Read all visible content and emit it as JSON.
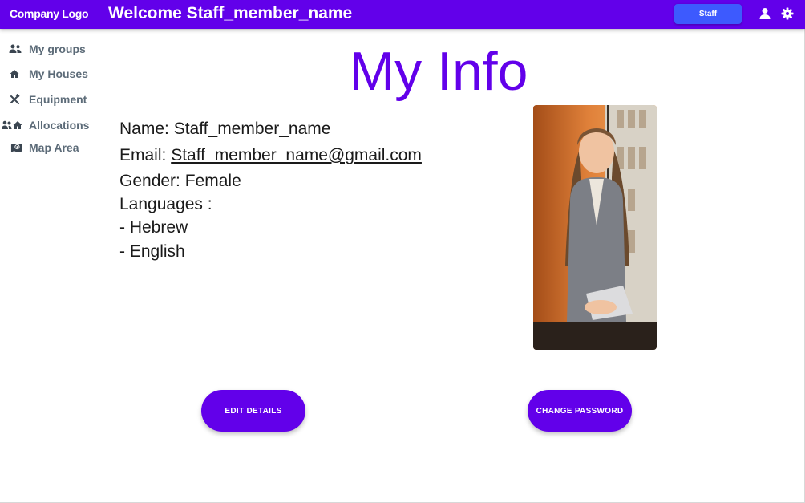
{
  "header": {
    "logo": "Company Logo",
    "welcome": "Welcome Staff_member_name",
    "role_button": "Staff",
    "icons": [
      "person-icon",
      "gear-icon"
    ]
  },
  "sidebar": {
    "items": [
      {
        "label": "My groups",
        "icon": "groups-icon"
      },
      {
        "label": "My Houses",
        "icon": "house-icon"
      },
      {
        "label": "Equipment",
        "icon": "tools-icon"
      },
      {
        "label": "Allocations",
        "icon": "allocations-icon"
      },
      {
        "label": "Map Area",
        "icon": "map-icon"
      }
    ]
  },
  "main": {
    "title": "My Info",
    "name_label": "Name:",
    "name_value": "Staff_member_name",
    "email_label": "Email:",
    "email_value": "Staff_member_name@gmail.com",
    "gender_label": "Gender:",
    "gender_value": "Female",
    "languages_label": "Languages :",
    "languages": [
      "- Hebrew",
      "- English"
    ],
    "edit_button": "EDIT DETAILS",
    "password_button": "CHANGE PASSWORD"
  },
  "colors": {
    "primary": "#6200ea",
    "role_button": "#3d5afe",
    "sidebar_text": "#5c6b78"
  }
}
